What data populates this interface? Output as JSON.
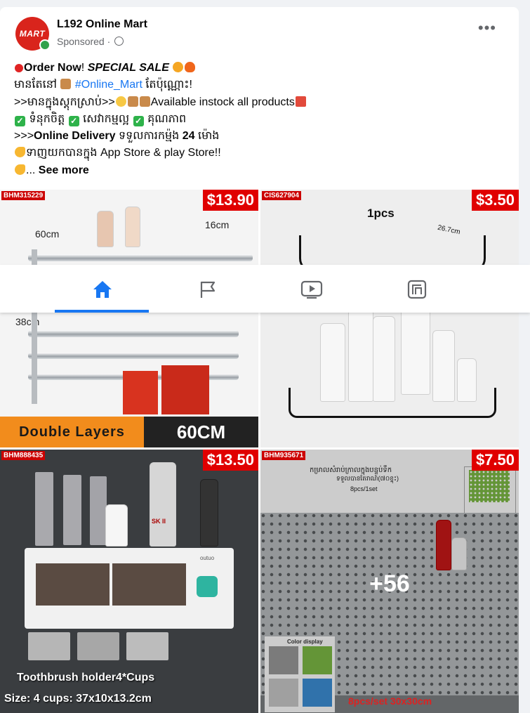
{
  "header": {
    "page_name": "L192 Online Mart",
    "avatar_text": "MART",
    "sponsored_label": "Sponsored",
    "sponsored_sep": " · "
  },
  "post": {
    "line1_a": "Order Now",
    "line1_b": "! ",
    "line1_c": "SPECIAL SALE",
    "line2_a": "មានតែនៅ ",
    "line2_hashtag": "#Online_Mart",
    "line2_b": " តែប៉ុណ្ណោះ!",
    "line3_a": ">>មានក្នុងស្តុកស្រាប់>>",
    "line3_b": "Available instock all products",
    "line4_a": "ទំនុកចិត្ត",
    "line4_b": "សេវាកម្មល្អ",
    "line4_c": "គុណភាព",
    "line5_a": ">>>",
    "line5_b": "Online Delivery",
    "line5_c": " ទទួលការកម្ម៉ង ",
    "line5_d": "24",
    "line5_e": " ម៉ោង",
    "line6": "ទាញយកបានក្នុង App Store & play Store!!",
    "line7_a": "... ",
    "line7_see_more": "See more"
  },
  "tiles": [
    {
      "code": "BHM315229",
      "price": "$13.90",
      "dim_width": "60cm",
      "dim_depth": "16cm",
      "dim_height": "38cm",
      "label_left": "Double Layers",
      "label_right": "60CM"
    },
    {
      "code": "CIS627904",
      "price": "$3.50",
      "qty": "1pcs",
      "dim": "26.7cm"
    },
    {
      "code": "BHM888435",
      "price": "$13.50",
      "caption": "Toothbrush holder4*Cups",
      "size": "Size: 4 cups: 37x10x13.2cm",
      "brand": "outuo",
      "product_label": "SK II"
    },
    {
      "code": "BHM935671",
      "price": "$7.50",
      "more_count": "+56",
      "kh_caption": "កម្រាលសំរាប់ក្រាលក្នុងបន្ទប់ទឹក",
      "kh_sub": "ទទួលបានតែរាណ៍(៧០ខ្ទុះ)",
      "kh_sub2": "8pcs/1set",
      "color_display": "Color display",
      "set_info": "8pcs/set 30x30cm"
    }
  ],
  "bottom_nav": {
    "items": [
      "home",
      "pages",
      "watch",
      "gaming"
    ],
    "active_color": "#1877f2",
    "inactive_color": "#65676b"
  }
}
